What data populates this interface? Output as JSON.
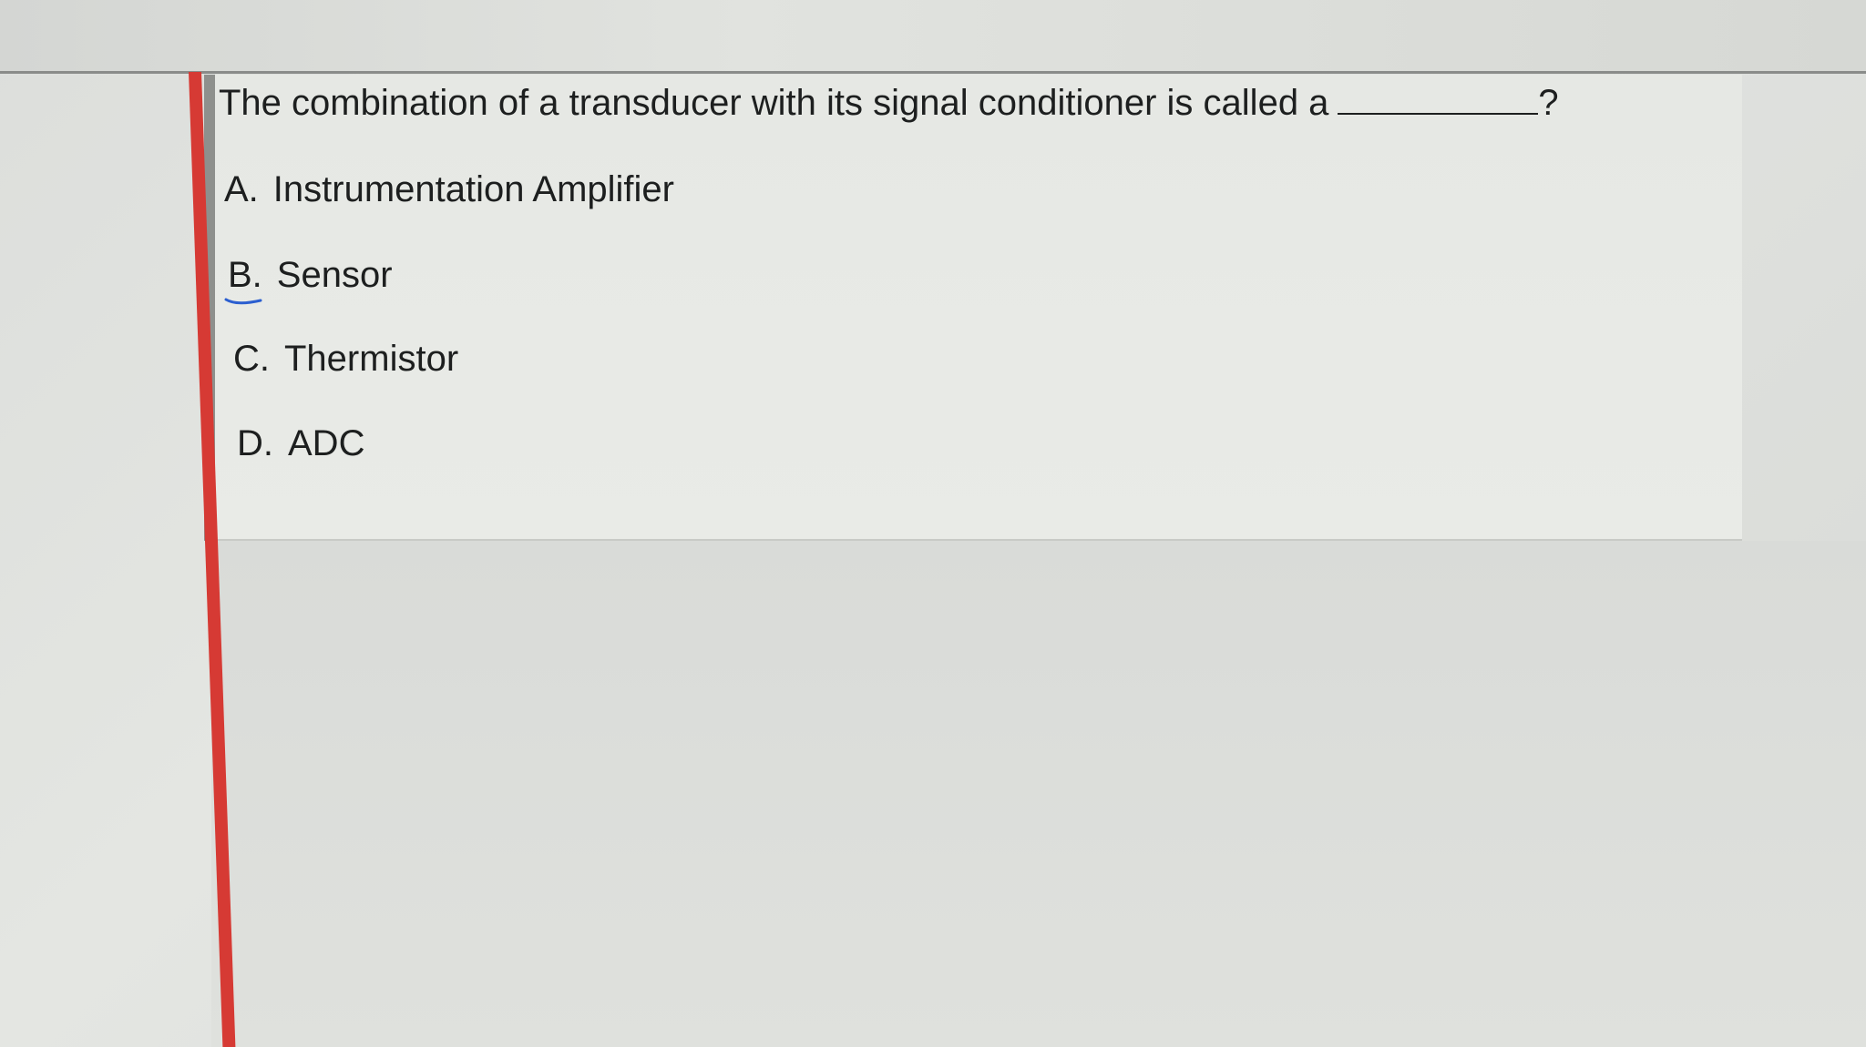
{
  "question": {
    "text": "The combination of a transducer with its signal conditioner is called a",
    "end": "?"
  },
  "options": [
    {
      "letter": "A.",
      "label": "Instrumentation Amplifier"
    },
    {
      "letter": "B.",
      "label": "Sensor"
    },
    {
      "letter": "C.",
      "label": "Thermistor"
    },
    {
      "letter": "D.",
      "label": "ADC"
    }
  ],
  "colors": {
    "accent_bar": "#d63a34",
    "pen_mark": "#2b5fd0"
  }
}
